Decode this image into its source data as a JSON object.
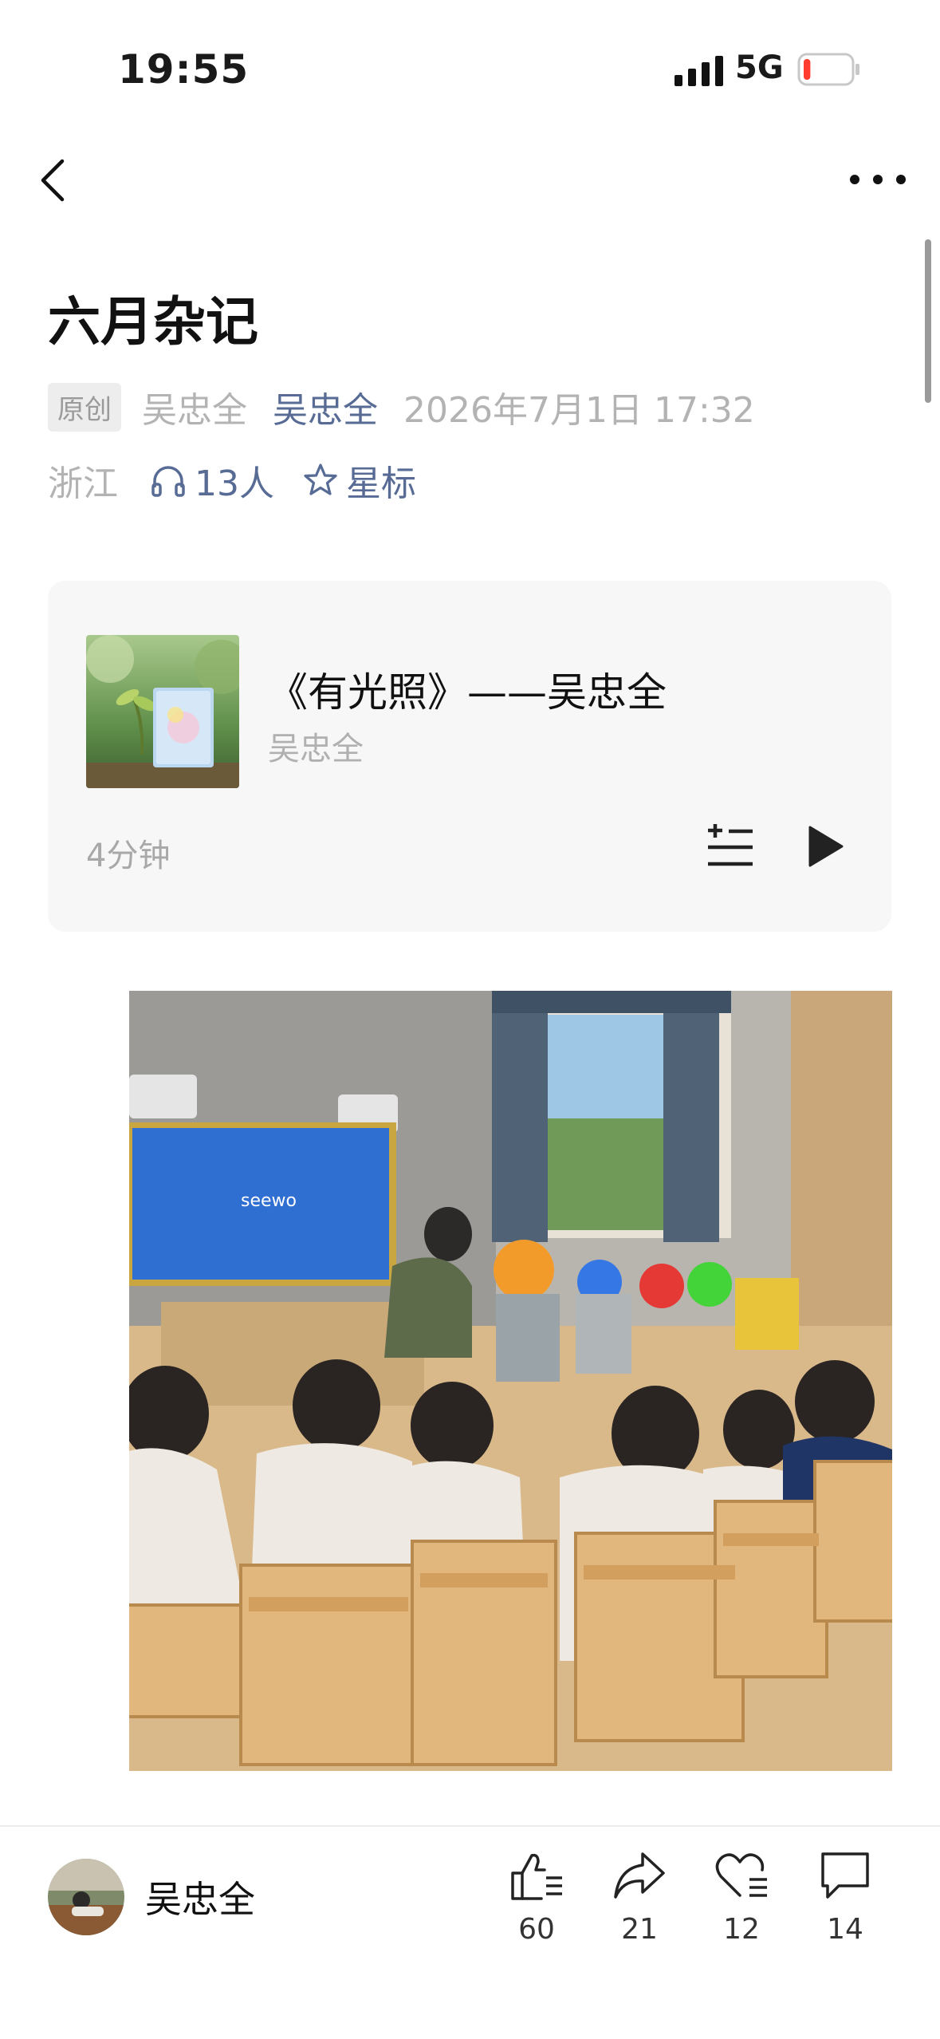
{
  "status_bar": {
    "time": "19:55",
    "network": "5G",
    "battery_level": 0.15
  },
  "article": {
    "title": "六月杂记",
    "original_badge": "原创",
    "author_plain": "吴忠全",
    "author_link": "吴忠全",
    "datetime": "2026年7月1日 17:32",
    "location": "浙江",
    "listeners": "13人",
    "star_label": "星标"
  },
  "audio": {
    "title": "《有光照》——吴忠全",
    "author": "吴忠全",
    "duration": "4分钟",
    "cover_icon": "book-cover-icon"
  },
  "footer": {
    "author": "吴忠全",
    "like_count": "60",
    "share_count": "21",
    "favorite_count": "12",
    "comment_count": "14"
  },
  "colors": {
    "link": "#576b95",
    "muted": "#b3b3b3",
    "card_bg": "#f7f7f7"
  }
}
